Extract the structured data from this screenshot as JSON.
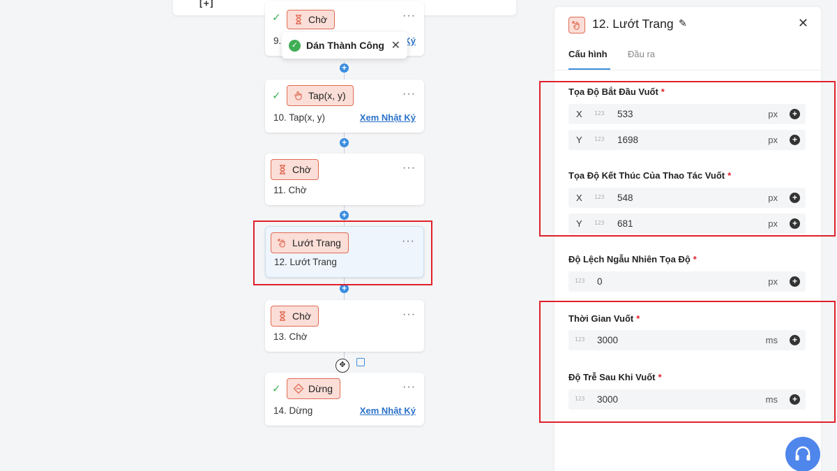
{
  "canvas": {
    "top_strip_label": "[+]",
    "toast": {
      "message": "Dán Thành Công"
    },
    "nodes": [
      {
        "chip": "Chờ",
        "title": "9.",
        "log": "Ký",
        "checked": true
      },
      {
        "chip": "Tap(x, y)",
        "title": "10. Tap(x, y)",
        "log": "Xem Nhật Ký",
        "checked": true
      },
      {
        "chip": "Chờ",
        "title": "11. Chờ",
        "log": "",
        "checked": false
      },
      {
        "chip": "Lướt Trang",
        "title": "12. Lướt Trang",
        "log": "",
        "checked": false,
        "selected": true
      },
      {
        "chip": "Chờ",
        "title": "13. Chờ",
        "log": "",
        "checked": false
      },
      {
        "chip": "Dừng",
        "title": "14. Dừng",
        "log": "Xem Nhật Ký",
        "checked": true
      }
    ],
    "menu_dots": "···"
  },
  "panel": {
    "title": "12. Lướt Trang",
    "tabs": {
      "config": "Cấu hình",
      "output": "Đầu ra"
    },
    "start": {
      "label": "Tọa Độ Bắt Đầu Vuốt",
      "x": {
        "axis": "X",
        "value": "533",
        "unit": "px"
      },
      "y": {
        "axis": "Y",
        "value": "1698",
        "unit": "px"
      }
    },
    "end": {
      "label": "Tọa Độ Kết Thúc Của Thao Tác Vuốt",
      "x": {
        "axis": "X",
        "value": "548",
        "unit": "px"
      },
      "y": {
        "axis": "Y",
        "value": "681",
        "unit": "px"
      }
    },
    "offset": {
      "label": "Độ Lệch Ngẫu Nhiên Tọa Độ",
      "value": "0",
      "unit": "px"
    },
    "duration": {
      "label": "Thời Gian Vuốt",
      "value": "3000",
      "unit": "ms"
    },
    "delay": {
      "label": "Độ Trễ Sau Khi Vuốt",
      "value": "3000",
      "unit": "ms"
    },
    "required_mark": "*",
    "num_icon": "123"
  },
  "colors": {
    "accent": "#3a8de0",
    "chip_bg": "#fbded7",
    "chip_border": "#e06b55",
    "highlight": "#e0202a",
    "success": "#3fae54"
  }
}
